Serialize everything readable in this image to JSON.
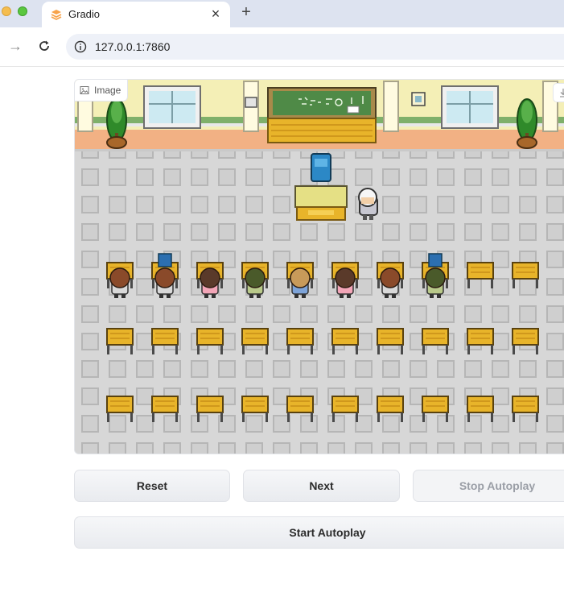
{
  "browser": {
    "tab_title": "Gradio",
    "tab_close": "×",
    "new_tab": "+",
    "url": "127.0.0.1:7860",
    "forward_icon": "arrow-right-icon",
    "reload_icon": "reload-icon",
    "info_icon": "info-icon"
  },
  "image_panel": {
    "label": "Image",
    "label_icon": "image-icon",
    "download_icon": "download-icon"
  },
  "buttons": {
    "reset": "Reset",
    "next": "Next",
    "stop_autoplay": "Stop Autoplay",
    "start_autoplay": "Start Autoplay"
  },
  "colors": {
    "tabstrip": "#dde3f0",
    "floor": "#d6d6d6",
    "wall": "#f4efb6",
    "wall_stripe": "#7fb06a",
    "baseboard": "#f2b184",
    "desk": "#e8b42a",
    "chalkboard": "#4f8a47",
    "teacher_desk": "#e5e085",
    "chair": "#2c88c6"
  }
}
